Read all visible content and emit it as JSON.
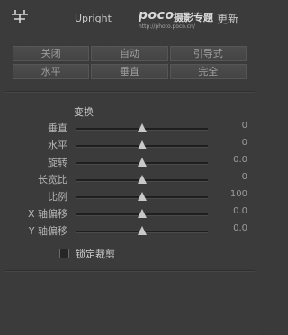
{
  "header": {
    "title": "Upright",
    "update_label": "更新",
    "watermark": {
      "brand": "poco",
      "tagline": "摄影专题",
      "url": "http://photo.poco.cn/"
    }
  },
  "mode_buttons_row1": [
    {
      "label": "关闭"
    },
    {
      "label": "自动"
    },
    {
      "label": "引导式"
    }
  ],
  "mode_buttons_row2": [
    {
      "label": "水平"
    },
    {
      "label": "垂直"
    },
    {
      "label": "完全"
    }
  ],
  "transform": {
    "title": "变换",
    "sliders": [
      {
        "label": "垂直",
        "value": "0",
        "fraction": 0.5
      },
      {
        "label": "水平",
        "value": "0",
        "fraction": 0.5
      },
      {
        "label": "旋转",
        "value": "0.0",
        "fraction": 0.5
      },
      {
        "label": "长宽比",
        "value": "0",
        "fraction": 0.5
      },
      {
        "label": "比例",
        "value": "100",
        "fraction": 0.5
      },
      {
        "label": "X 轴偏移",
        "value": "0.0",
        "fraction": 0.5
      },
      {
        "label": "Y 轴偏移",
        "value": "0.0",
        "fraction": 0.5
      }
    ],
    "lock_crop_label": "锁定裁剪",
    "lock_crop_checked": false
  }
}
